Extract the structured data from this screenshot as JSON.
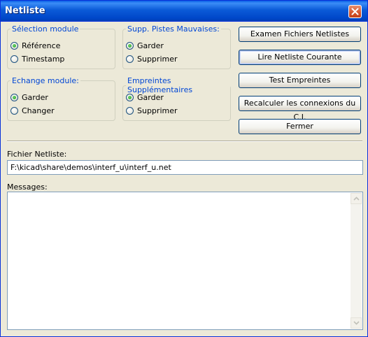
{
  "window": {
    "title": "Netliste"
  },
  "groups": {
    "selection_module": {
      "legend": "Sélection module",
      "options": [
        "Référence",
        "Timestamp"
      ],
      "selected": "Référence"
    },
    "supp_pistes": {
      "legend": "Supp. Pistes Mauvaises:",
      "options": [
        "Garder",
        "Supprimer"
      ],
      "selected": "Garder"
    },
    "echange_module": {
      "legend": "Echange module:",
      "options": [
        "Garder",
        "Changer"
      ],
      "selected": "Garder"
    },
    "empreintes_supp": {
      "legend": "Empreintes Supplémentaires",
      "options": [
        "Garder",
        "Supprimer"
      ],
      "selected": "Garder"
    }
  },
  "buttons": {
    "examen": "Examen Fichiers Netlistes",
    "lire": "Lire Netliste Courante",
    "test": "Test Empreintes",
    "recalculer": "Recalculer les connexions du C.I.",
    "fermer": "Fermer"
  },
  "fichier": {
    "label": "Fichier Netliste:",
    "value": "F:\\kicad\\share\\demos\\interf_u\\interf_u.net"
  },
  "messages": {
    "label": "Messages:",
    "value": ""
  }
}
